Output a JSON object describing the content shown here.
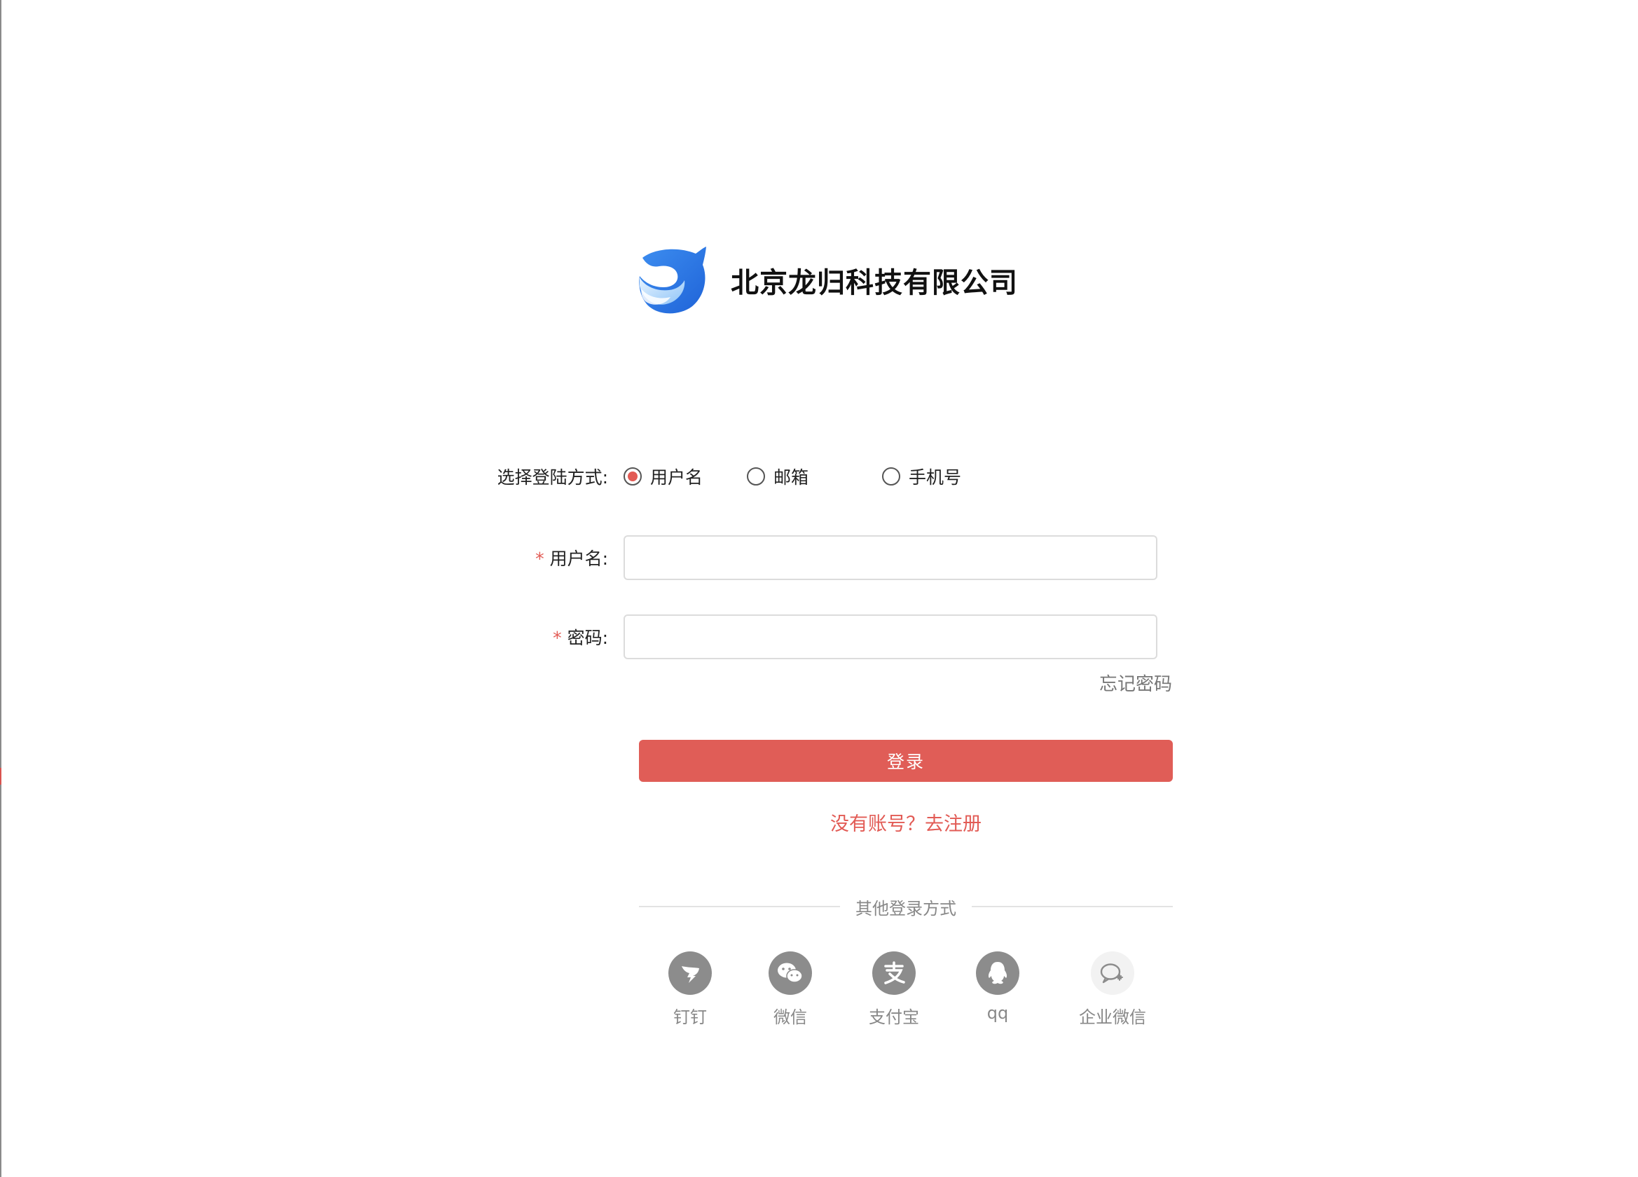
{
  "brand": {
    "company_name": "北京龙归科技有限公司",
    "logo_icon": "dolphin-logo-icon",
    "logo_colors": [
      "#2f7bea",
      "#6fb2f7",
      "#c8e3fc"
    ]
  },
  "login_method": {
    "label": "选择登陆方式:",
    "options": [
      {
        "label": "用户名",
        "checked": true
      },
      {
        "label": "邮箱",
        "checked": false
      },
      {
        "label": "手机号",
        "checked": false
      }
    ]
  },
  "form": {
    "username": {
      "label": "用户名:",
      "required_mark": "*",
      "value": "",
      "placeholder": ""
    },
    "password": {
      "label": "密码:",
      "required_mark": "*",
      "value": "",
      "placeholder": ""
    },
    "forgot_password": "忘记密码",
    "login_button": "登录",
    "register_link": "没有账号？去注册"
  },
  "other_login": {
    "title": "其他登录方式",
    "options": [
      {
        "label": "钉钉",
        "icon": "dingtalk-icon"
      },
      {
        "label": "微信",
        "icon": "wechat-icon"
      },
      {
        "label": "支付宝",
        "icon": "alipay-icon"
      },
      {
        "label": "qq",
        "icon": "qq-icon"
      },
      {
        "label": "企业微信",
        "icon": "wecom-icon"
      }
    ]
  },
  "colors": {
    "accent": "#e05d57",
    "text": "#222222",
    "muted": "#888888",
    "border": "#dcdcdc"
  }
}
